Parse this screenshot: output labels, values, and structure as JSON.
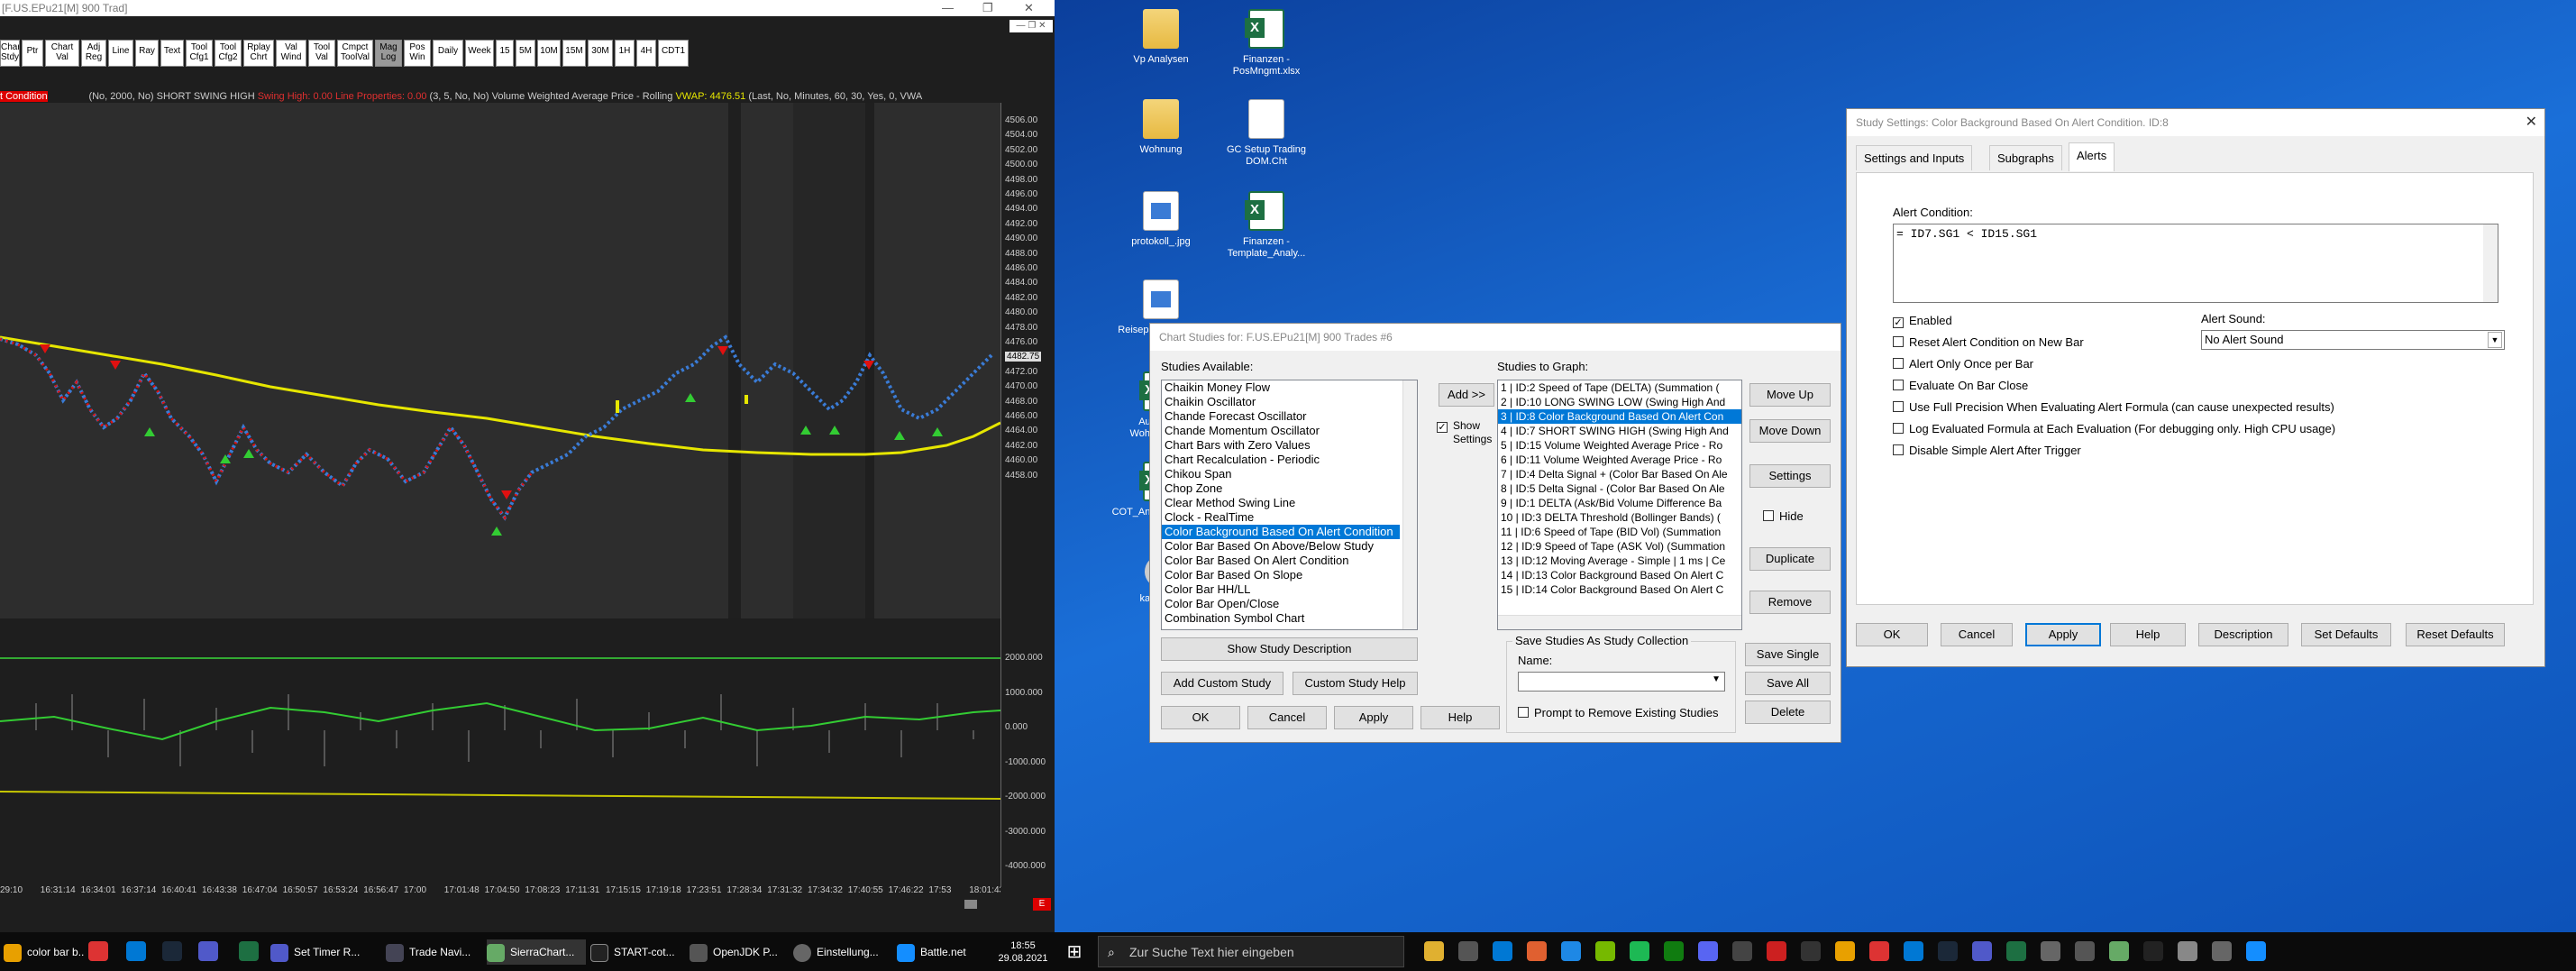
{
  "left_window": {
    "title": "[F.US.EPu21[M]  900 Trad]",
    "toolbar_buttons": [
      "Chart Stdy",
      "Ptr",
      "Chart Val",
      "Adj Reg",
      "Line",
      "Ray",
      "Text",
      "Tool Cfg1",
      "Tool Cfg2",
      "Rplay Chrt",
      "Val Wind",
      "Tool Val",
      "Cmpct ToolVal",
      "Mag Log",
      "Pos Win",
      "Daily",
      "Week",
      "15",
      "5M",
      "10M",
      "15M",
      "30M",
      "1H",
      "4H",
      "CDT1"
    ],
    "study_bar": {
      "prefix": "t Condition",
      "text": "(No, 2000, No)  SHORT SWING HIGH",
      "swing": "Swing High: 0.00",
      "line_props": "Line Properties: 0.00",
      "rest": "(3, 5, No, No)  Volume Weighted Average Price - Rolling",
      "vwap": "VWAP: 4476.51",
      "tail": "(Last, No, Minutes, 60, 30, Yes, 0, VWA"
    },
    "price_labels": [
      "4506.00",
      "4504.00",
      "4502.00",
      "4500.00",
      "4498.00",
      "4496.00",
      "4494.00",
      "4492.00",
      "4490.00",
      "4488.00",
      "4486.00",
      "4484.00",
      "4482.00",
      "4480.00",
      "4478.00",
      "4476.00",
      "4474.00",
      "4472.00",
      "4470.00",
      "4468.00",
      "4466.00",
      "4464.00",
      "4462.00",
      "4460.00",
      "4458.00"
    ],
    "price_marker": "4482.75",
    "lower_labels": [
      "2000.000",
      "1000.000",
      "0.000",
      "-1000.000",
      "-2000.000",
      "-3000.000",
      "-4000.000"
    ],
    "time_labels": [
      "29:10",
      "16:31:14",
      "16:34:01",
      "16:37:14",
      "16:40:41",
      "16:43:38",
      "16:47:04",
      "16:50:57",
      "16:53:24",
      "16:56:47",
      "17:00",
      "17:01:48",
      "17:04:50",
      "17:08:23",
      "17:11:31",
      "17:15:15",
      "17:19:18",
      "17:23:51",
      "17:28:34",
      "17:31:32",
      "17:34:32",
      "17:40:55",
      "17:46:22",
      "17:53",
      "18:01:43"
    ],
    "corner_badge": "E"
  },
  "desktop_icons": [
    {
      "label": "Vp Analysen",
      "kind": "folder"
    },
    {
      "label": "Finanzen - PosMngmt.xlsx",
      "kind": "excel"
    },
    {
      "label": "Wohnung",
      "kind": "folder"
    },
    {
      "label": "GC Setup Trading DOM.Cht",
      "kind": "doc"
    },
    {
      "label": "protokoll_.jpg",
      "kind": "img"
    },
    {
      "label": "Finanzen - Template_Analy...",
      "kind": "excel"
    },
    {
      "label": "Reisepass Luigi.jpg",
      "kind": "img"
    },
    {
      "label": "Ausgaben Wohnung.xlsx",
      "kind": "excel"
    },
    {
      "label": "COT_Analyse_Groß...",
      "kind": "excel"
    },
    {
      "label": "kasse.bat",
      "kind": "gear"
    }
  ],
  "chart_studies": {
    "title": "Chart Studies for: F.US.EPu21[M]  900 Trades  #6",
    "available_label": "Studies Available:",
    "available": [
      "Chaikin Money Flow",
      "Chaikin Oscillator",
      "Chande Forecast Oscillator",
      "Chande Momentum Oscillator",
      "Chart Bars with Zero Values",
      "Chart Recalculation - Periodic",
      "Chikou Span",
      "Chop Zone",
      "Clear Method Swing Line",
      "Clock - RealTime",
      "Color Background Based On Alert Condition",
      "Color Bar Based On Above/Below Study",
      "Color Bar Based On Alert Condition",
      "Color Bar Based On Slope",
      "Color Bar HH/LL",
      "Color Bar Open/Close",
      "Combination Symbol Chart"
    ],
    "selected_available": "Color Background Based On Alert Condition",
    "graph_label": "Studies to Graph:",
    "graph": [
      "1 | ID:2  Speed of Tape (DELTA) (Summation (",
      "2 | ID:10  LONG SWING LOW (Swing High And",
      "3 | ID:8  Color Background Based On Alert Con",
      "4 | ID:7  SHORT SWING HIGH (Swing High And",
      "5 | ID:15  Volume Weighted Average Price - Ro",
      "6 | ID:11  Volume Weighted Average Price - Ro",
      "7 | ID:4  Delta Signal + (Color Bar Based On Ale",
      "8 | ID:5  Delta Signal - (Color Bar Based On Ale",
      "9 | ID:1  DELTA (Ask/Bid Volume Difference Ba",
      "10 | ID:3  DELTA Threshold (Bollinger Bands) (",
      "11 | ID:6  Speed of Tape (BID Vol) (Summation",
      "12 | ID:9  Speed of Tape (ASK Vol) (Summation",
      "13 | ID:12  Moving Average - Simple | 1 ms | Ce",
      "14 | ID:13  Color Background Based On Alert C",
      "15 | ID:14  Color Background Based On Alert C"
    ],
    "selected_graph_index": 2,
    "add_button": "Add >>",
    "show_settings": "Show Settings",
    "move_up": "Move Up",
    "move_down": "Move Down",
    "settings": "Settings",
    "hide": "Hide",
    "duplicate": "Duplicate",
    "remove": "Remove",
    "show_desc": "Show Study Description",
    "add_custom": "Add Custom Study",
    "custom_help": "Custom Study Help",
    "collection_label": "Save Studies As Study Collection",
    "name_label": "Name:",
    "save_single": "Save Single",
    "save_all": "Save All",
    "delete": "Delete",
    "prompt_remove": "Prompt to Remove Existing Studies",
    "ok": "OK",
    "cancel": "Cancel",
    "apply": "Apply",
    "help": "Help"
  },
  "study_settings": {
    "title": "Study Settings: Color Background Based On Alert Condition. ID:8",
    "tabs": [
      "Settings and Inputs",
      "Subgraphs",
      "Alerts"
    ],
    "active_tab": "Alerts",
    "alert_condition_label": "Alert Condition:",
    "alert_formula": "= ID7.SG1 < ID15.SG1",
    "checkboxes": [
      {
        "label": "Enabled",
        "checked": true
      },
      {
        "label": "Reset Alert Condition on New Bar",
        "checked": false
      },
      {
        "label": "Alert Only Once per Bar",
        "checked": false
      },
      {
        "label": "Evaluate On Bar Close",
        "checked": false
      },
      {
        "label": "Use Full Precision When Evaluating Alert Formula (can cause unexpected results)",
        "checked": false
      },
      {
        "label": "Log Evaluated Formula at Each Evaluation (For debugging only. High CPU usage)",
        "checked": false
      },
      {
        "label": "Disable Simple Alert After Trigger",
        "checked": false
      }
    ],
    "alert_sound_label": "Alert Sound:",
    "alert_sound_value": "No Alert Sound",
    "buttons": [
      "OK",
      "Cancel",
      "Apply",
      "Help",
      "Description",
      "Set Defaults",
      "Reset Defaults"
    ],
    "close": "✕"
  },
  "taskbar_left": {
    "items": [
      "color bar b...",
      "Set Timer R...",
      "Trade Navi...",
      "SierraChart...",
      "START-cot...",
      "OpenJDK P...",
      "Einstellung...",
      "Battle.net"
    ],
    "time": "18:55",
    "date": "29.08.2021"
  },
  "taskbar_right": {
    "search_placeholder": "Zur Suche Text hier eingeben"
  },
  "colors": {
    "accent": "#0078d7",
    "chart_bg": "#2d2d2d",
    "bar_up": "#3a7bd5",
    "bar_down": "#e01010",
    "vwap": "#e6e600",
    "signal": "#33cc33"
  }
}
